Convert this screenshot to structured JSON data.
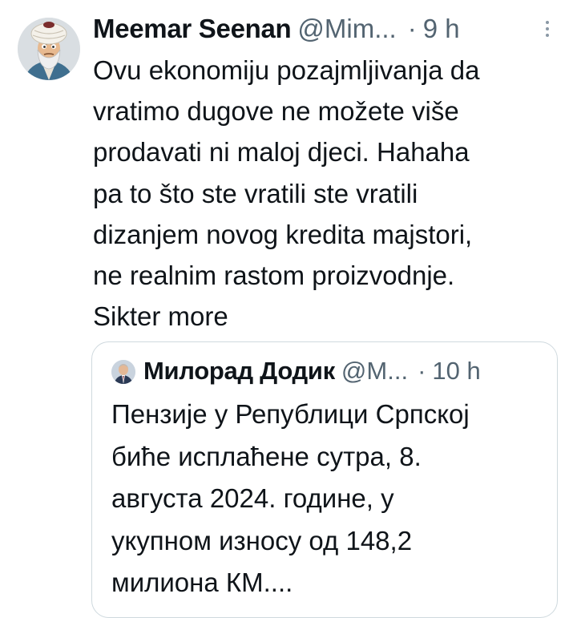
{
  "tweet": {
    "author_name": "Meemar Seenan",
    "author_handle": "@Mim...",
    "separator": "·",
    "time": "9 h",
    "avatar_icon": "cartoon-man-with-turban-avatar",
    "more_icon": "more-vertical-icon",
    "text": "Ovu ekonomiju pozajmljivanja da\nvratimo dugove ne možete više\nprodavati ni maloj djeci. Hahaha\npa to što ste vratili ste vratili\ndizanjem novog kredita majstori,\nne realnim rastom proizvodnje.\nSikter more"
  },
  "quoted_tweet": {
    "author_name": "Милорад Додик",
    "author_handle": "@M...",
    "separator": "·",
    "time": "10 h",
    "avatar_icon": "man-in-suit-avatar",
    "text": "Пензије у Републици Српској\nбиће исплаћене сутра, 8.\nавгуста 2024. године, у\nукупном износу од 148,2\nмилиона КМ...."
  },
  "colors": {
    "text_primary": "#0f1419",
    "text_secondary": "#536471",
    "border": "#cfd9de",
    "background": "#ffffff"
  }
}
